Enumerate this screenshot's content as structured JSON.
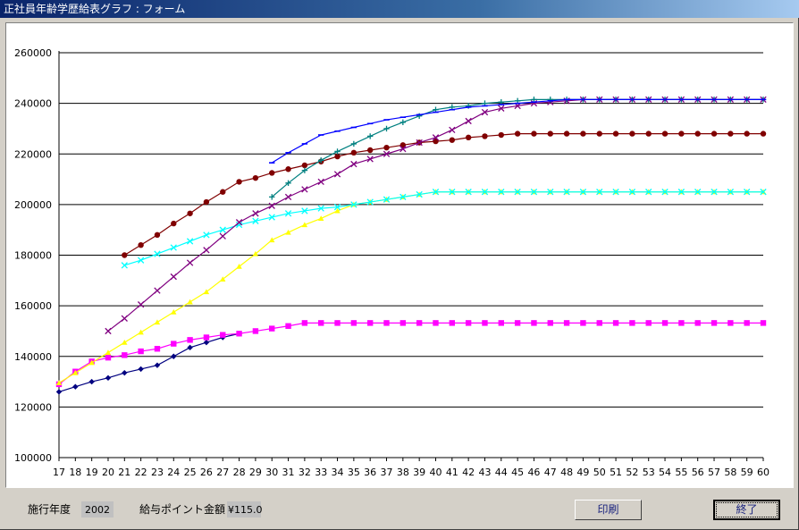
{
  "window": {
    "title": "正社員年齢学歴給表グラフ : フォーム"
  },
  "status": {
    "year_label": "施行年度",
    "year_value": "2002",
    "point_label": "給与ポイント金額",
    "point_value": "¥115.0",
    "print_label": "印刷",
    "close_label": "終了"
  },
  "chart_data": {
    "type": "line",
    "xlabel": "",
    "ylabel": "",
    "x": [
      17,
      18,
      19,
      20,
      21,
      22,
      23,
      24,
      25,
      26,
      27,
      28,
      29,
      30,
      31,
      32,
      33,
      34,
      35,
      36,
      37,
      38,
      39,
      40,
      41,
      42,
      43,
      44,
      45,
      46,
      47,
      48,
      49,
      50,
      51,
      52,
      53,
      54,
      55,
      56,
      57,
      58,
      59,
      60
    ],
    "ylim": [
      100000,
      260000
    ],
    "yticks": [
      100000,
      120000,
      140000,
      160000,
      180000,
      200000,
      220000,
      240000,
      260000
    ],
    "grid": true,
    "series": [
      {
        "color": "#000080",
        "marker": "diamond",
        "start": 17,
        "values": [
          126000,
          128000,
          130000,
          131500,
          133500,
          135000,
          136500,
          140000,
          143500,
          145500,
          147500,
          149000
        ]
      },
      {
        "color": "#ff00ff",
        "marker": "square",
        "start": 17,
        "values": [
          129000,
          134000,
          138000,
          139500,
          140500,
          142000,
          143000,
          145000,
          146500,
          147500,
          148500,
          149000,
          150000,
          151000,
          152000,
          153200,
          153200,
          153200,
          153200,
          153200,
          153200,
          153200,
          153200,
          153200,
          153200,
          153200,
          153200,
          153200,
          153200,
          153200,
          153200,
          153200,
          153200,
          153200,
          153200,
          153200,
          153200,
          153200,
          153200,
          153200,
          153200,
          153200,
          153200,
          153200
        ]
      },
      {
        "color": "#ffff00",
        "marker": "triangle",
        "start": 17,
        "values": [
          129500,
          133500,
          137500,
          141500,
          145500,
          149500,
          153500,
          157500,
          161500,
          165500,
          170500,
          175500,
          180500,
          186000,
          189000,
          192000,
          194500,
          197500,
          200000,
          201000,
          202000,
          203000,
          204000,
          205000,
          205000,
          205000,
          205000,
          205000,
          205000,
          205000,
          205000,
          205000,
          205000,
          205000,
          205000,
          205000,
          205000,
          205000,
          205000,
          205000,
          205000,
          205000,
          205000,
          205000
        ]
      },
      {
        "color": "#800000",
        "marker": "circle",
        "start": 21,
        "values": [
          180000,
          184000,
          188000,
          192500,
          196500,
          201000,
          205000,
          209000,
          210500,
          212500,
          214000,
          215500,
          217000,
          219000,
          220500,
          221500,
          222500,
          223500,
          224500,
          225000,
          225500,
          226500,
          227000,
          227500,
          228000,
          228000,
          228000,
          228000,
          228000,
          228000,
          228000,
          228000,
          228000,
          228000,
          228000,
          228000,
          228000,
          228000,
          228000,
          228000
        ]
      },
      {
        "color": "#00ffff",
        "marker": "x",
        "start": 21,
        "values": [
          176000,
          178000,
          180500,
          183000,
          185500,
          188000,
          190000,
          192000,
          193500,
          195000,
          196500,
          197500,
          198500,
          199000,
          200000,
          201000,
          202000,
          203000,
          204000,
          205000,
          205000,
          205000,
          205000,
          205000,
          205000,
          205000,
          205000,
          205000,
          205000,
          205000,
          205000,
          205000,
          205000,
          205000,
          205000,
          205000,
          205000,
          205000,
          205000,
          205000
        ]
      },
      {
        "color": "#800080",
        "marker": "x",
        "start": 20,
        "values": [
          150000,
          155000,
          160500,
          166000,
          171500,
          177000,
          182000,
          187500,
          193000,
          196500,
          199500,
          203000,
          206000,
          209000,
          212000,
          216000,
          218000,
          220000,
          222000,
          224500,
          226500,
          229500,
          233000,
          236500,
          238000,
          239000,
          240000,
          240500,
          241000,
          241500,
          241500,
          241500,
          241500,
          241500,
          241500,
          241500,
          241500,
          241500,
          241500,
          241500,
          241500
        ]
      },
      {
        "color": "#008080",
        "marker": "cross",
        "start": 30,
        "values": [
          203000,
          208500,
          213500,
          217500,
          221000,
          224000,
          227000,
          230000,
          232500,
          235000,
          237500,
          238500,
          239000,
          240000,
          240500,
          241000,
          241500,
          241500,
          241500,
          241500,
          241500,
          241500,
          241500,
          241500,
          241500,
          241500,
          241500,
          241500,
          241500,
          241500,
          241500
        ]
      },
      {
        "color": "#0000ff",
        "marker": "dash",
        "start": 30,
        "values": [
          216500,
          220500,
          224000,
          227500,
          229000,
          230500,
          232000,
          233500,
          234500,
          235500,
          236500,
          237500,
          238500,
          239000,
          239500,
          240000,
          240500,
          241000,
          241500,
          241500,
          241500,
          241500,
          241500,
          241500,
          241500,
          241500,
          241500,
          241500,
          241500,
          241500,
          241500
        ]
      }
    ]
  }
}
